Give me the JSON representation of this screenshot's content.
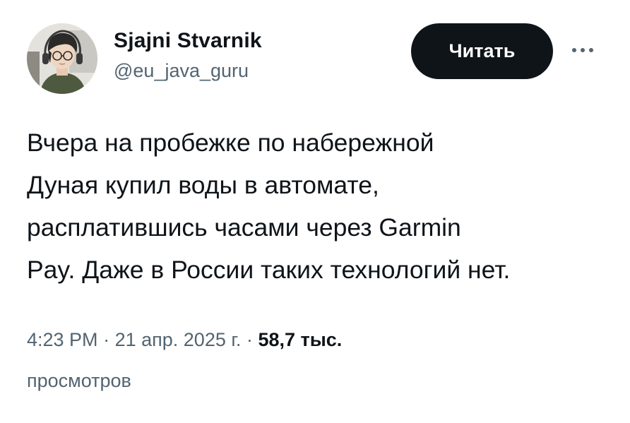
{
  "author": {
    "display_name": "Sjajni Stvarnik",
    "handle": "@eu_java_guru"
  },
  "follow_button": {
    "label": "Читать"
  },
  "more_button": {
    "icon": "more-horizontal-icon"
  },
  "tweet": {
    "lines": [
      "Вчера на пробежке по набережной",
      "Дуная купил воды в автомате,",
      "расплатившись часами через Garmin",
      "Pay. Даже в России таких технологий нет."
    ]
  },
  "meta": {
    "time": "4:23 PM",
    "separator": "·",
    "date": "21 апр. 2025 г.",
    "views_count": "58,7 тыс.",
    "views_label": "просмотров"
  },
  "colors": {
    "text_primary": "#0f1419",
    "text_secondary": "#536471",
    "button_bg": "#0f1419",
    "button_text": "#ffffff",
    "background": "#ffffff"
  }
}
